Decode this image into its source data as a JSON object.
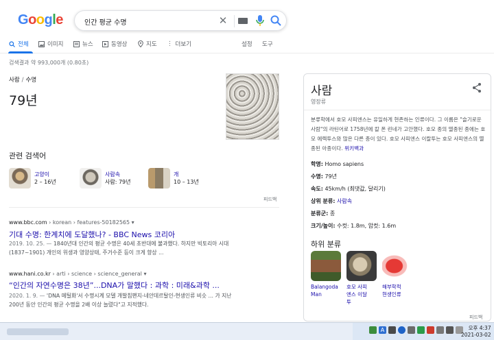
{
  "logo": [
    "G",
    "o",
    "o",
    "g",
    "l",
    "e"
  ],
  "logo_colors": [
    "#4285f4",
    "#ea4335",
    "#fbbc05",
    "#4285f4",
    "#34a853",
    "#ea4335"
  ],
  "search": {
    "query": "인간 평균 수명"
  },
  "tabs": {
    "all": "전체",
    "images": "이미지",
    "news": "뉴스",
    "videos": "동영상",
    "maps": "지도",
    "more": "더보기",
    "settings": "설정",
    "tools": "도구"
  },
  "stats": "검색결과 약 993,000개 (0.80초)",
  "answer": {
    "crumb1": "사람",
    "crumb2": "수명",
    "value": "79년"
  },
  "related": {
    "title": "관련 검색어",
    "items": [
      {
        "name": "고양이",
        "value": "2 – 16년"
      },
      {
        "name": "사람속",
        "value": "사람: 79년"
      },
      {
        "name": "개",
        "value": "10 – 13년"
      }
    ],
    "feedback": "피드백"
  },
  "results": [
    {
      "site": "www.bbc.com",
      "path": " › korean › features-50182565",
      "more": "▾",
      "title": "기대 수명: 한계치에 도달했나? - BBC News 코리아",
      "date": "2019. 10. 25. — ",
      "snippet1": "1840년대 인간의 평균 수명은 40세 초반대에 불과했다. 하지만 빅토리아 시대",
      "snippet2": "(1837~1901) 개인의 위생과 영양상태, 주거수준 등이 크게 향상 ..."
    },
    {
      "site": "www.hani.co.kr",
      "path": " › arti › science › science_general",
      "more": "▾",
      "title": "“인간의 자연수명은 38년”...DNA가 말했다 : 과학 : 미래&과학 ...",
      "date": "2020. 1. 9. — ",
      "snippet1": "'DNA 메틸화'서 수명시계 모델 개발침팬지-네안데르탈인-현생인류 비슷 ... 가 지난",
      "snippet2": "200년 동안 인간의 평균 수명을 2배 이상 늘렸다\"고 지적했다."
    }
  ],
  "kp": {
    "title": "사람",
    "subtitle": "영장류",
    "description": "분류학에서 호모 사피엔스는 유일하게 현존하는 인류이다. 그 이름은 \"슬기로운 사람\"의 라틴어로 1758년에 칼 폰 린네가 고안했다. 호모 종의 멸종된 종에는 호모 에렉투스와 많은 다른 종이 있다. 호모 사피엔스 이랄투는 호모 사피엔스의 멸종된 아종이다.",
    "source": "위키백과",
    "facts": [
      {
        "label": "학명:",
        "value": "Homo sapiens",
        "link": false
      },
      {
        "label": "수명:",
        "value": "79년",
        "link": false
      },
      {
        "label": "속도:",
        "value": "45km/h (최댓값, 달리기)",
        "link": false
      },
      {
        "label": "상위 분류:",
        "value": "사람속",
        "link": true
      },
      {
        "label": "분류군:",
        "value": "종",
        "link": false
      },
      {
        "label": "크기/높이:",
        "value": "수컷: 1.8m, 암컷: 1.6m",
        "link": false
      }
    ],
    "sub_title": "하위 분류",
    "sub_items": [
      {
        "l1": "Balangoda",
        "l2": "Man",
        "l3": ""
      },
      {
        "l1": "호모 사피",
        "l2": "엔스 이달",
        "l3": "투"
      },
      {
        "l1": "해부학적",
        "l2": "현생인류",
        "l3": ""
      }
    ],
    "feedback": "피드백"
  },
  "taskbar": {
    "time": "오후 4:37",
    "date": "2021-03-02"
  }
}
